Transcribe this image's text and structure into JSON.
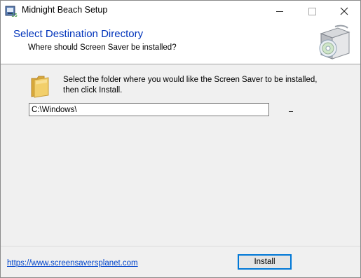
{
  "window": {
    "title": "Midnight Beach Setup",
    "app_icon": "installer-icon"
  },
  "header": {
    "title": "Select Destination Directory",
    "subtitle": "Where should Screen Saver be installed?",
    "icon": "install-disc-box-icon"
  },
  "body": {
    "folder_icon": "folder-icon",
    "instructions": "Select the folder where you would like the Screen Saver to be installed, then click Install.",
    "path_value": "C:\\Windows\\"
  },
  "footer": {
    "link_text": "https://www.screensaversplanet.com",
    "install_label": "Install"
  },
  "colors": {
    "header_title": "#0033bb",
    "link": "#0044cc",
    "button_focus_border": "#0078d7"
  }
}
